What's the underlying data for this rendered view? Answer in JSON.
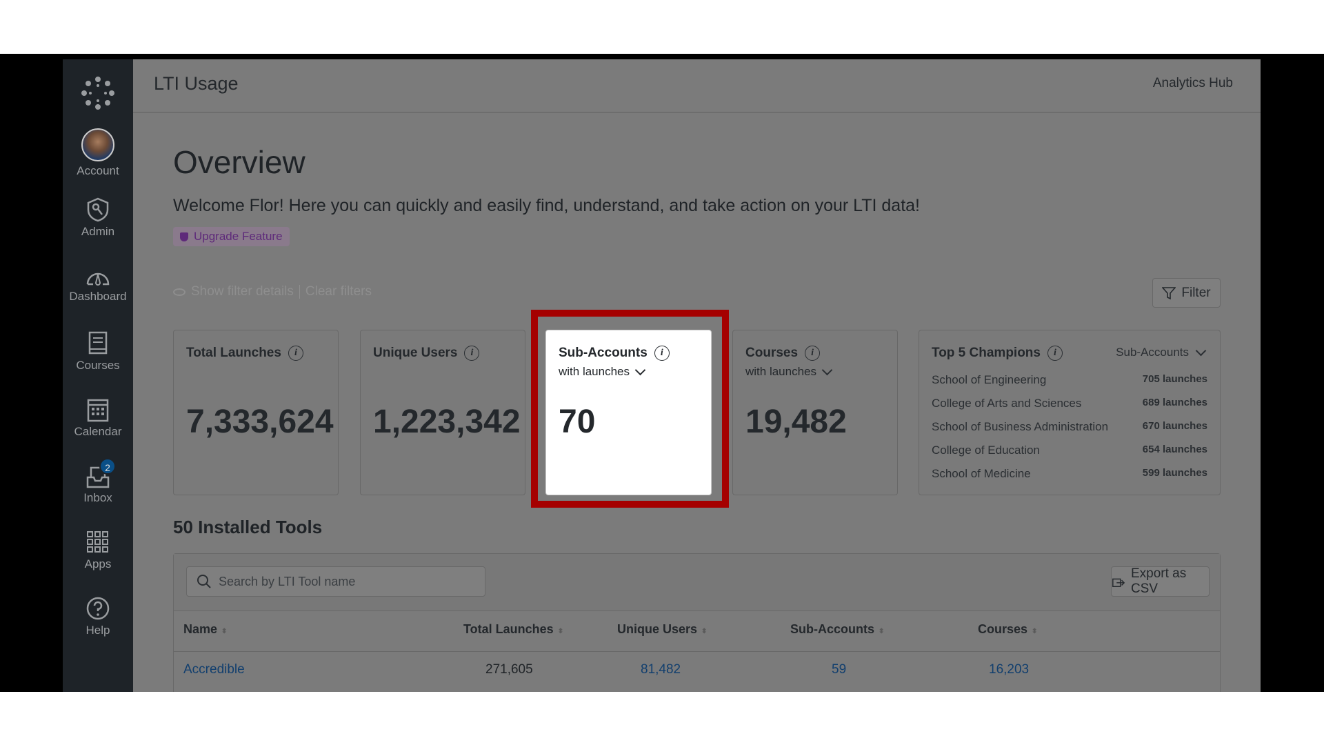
{
  "sidebar": {
    "items": [
      {
        "label": "Account",
        "icon": "avatar"
      },
      {
        "label": "Admin",
        "icon": "shield-key-icon"
      },
      {
        "label": "Dashboard",
        "icon": "dashboard-icon"
      },
      {
        "label": "Courses",
        "icon": "courses-icon"
      },
      {
        "label": "Calendar",
        "icon": "calendar-icon"
      },
      {
        "label": "Inbox",
        "icon": "inbox-icon",
        "badge": "2"
      },
      {
        "label": "Apps",
        "icon": "apps-icon"
      },
      {
        "label": "Help",
        "icon": "help-icon"
      }
    ]
  },
  "header": {
    "title": "LTI Usage",
    "right_link": "Analytics Hub"
  },
  "overview": {
    "title": "Overview",
    "welcome": "Welcome Flor! Here you can quickly and easily find, understand, and take action on your LTI data!",
    "upgrade_badge": "Upgrade Feature",
    "show_filter_details": "Show filter details",
    "clear_filters": "Clear filters",
    "filter_button": "Filter"
  },
  "cards": {
    "total_launches": {
      "title": "Total Launches",
      "value": "7,333,624"
    },
    "unique_users": {
      "title": "Unique Users",
      "value": "1,223,342"
    },
    "sub_accounts": {
      "title": "Sub-Accounts",
      "subtitle": "with launches",
      "value": "70"
    },
    "courses": {
      "title": "Courses",
      "subtitle": "with launches",
      "value": "19,482"
    },
    "champions": {
      "title": "Top 5 Champions",
      "selector": "Sub-Accounts",
      "items": [
        {
          "name": "School of Engineering",
          "launches": "705 launches"
        },
        {
          "name": "College of Arts and Sciences",
          "launches": "689 launches"
        },
        {
          "name": "School of Business Administration",
          "launches": "670 launches"
        },
        {
          "name": "College of Education",
          "launches": "654 launches"
        },
        {
          "name": "School of Medicine",
          "launches": "599 launches"
        }
      ]
    }
  },
  "tools": {
    "heading": "50 Installed Tools",
    "search_placeholder": "Search by LTI Tool name",
    "export_button": "Export as CSV",
    "columns": [
      "Name",
      "Total Launches",
      "Unique Users",
      "Sub-Accounts",
      "Courses"
    ],
    "rows": [
      {
        "name": "Accredible",
        "total_launches": "271,605",
        "unique_users": "81,482",
        "sub_accounts": "59",
        "courses": "16,203"
      }
    ]
  },
  "colors": {
    "highlight": "#a50000",
    "link": "#123f6e",
    "upgrade": "#5e2a7a"
  }
}
